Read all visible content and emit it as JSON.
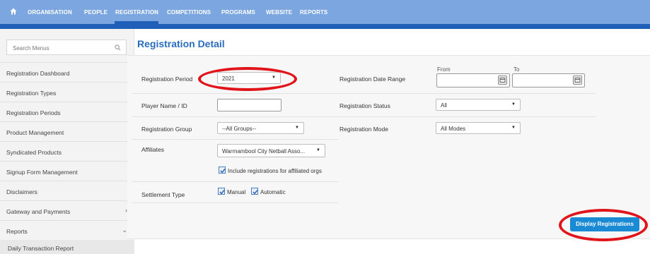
{
  "topnav": {
    "items": [
      "ORGANISATION",
      "PEOPLE",
      "REGISTRATION",
      "COMPETITIONS",
      "PROGRAMS",
      "WEBSITE",
      "REPORTS"
    ]
  },
  "sidebar": {
    "search_placeholder": "Search Menus",
    "items": [
      {
        "label": "Registration Dashboard"
      },
      {
        "label": "Registration Types"
      },
      {
        "label": "Registration Periods"
      },
      {
        "label": "Product Management"
      },
      {
        "label": "Syndicated Products"
      },
      {
        "label": "Signup Form Management"
      },
      {
        "label": "Disclaimers"
      },
      {
        "label": "Gateway and Payments",
        "chevron": "›"
      },
      {
        "label": "Reports",
        "chevron": "⌄"
      }
    ],
    "subitems": [
      {
        "label": "Daily Transaction Report"
      }
    ]
  },
  "main": {
    "title": "Registration Detail",
    "form": {
      "registration_period": {
        "label": "Registration Period",
        "value": "2021"
      },
      "player_name": {
        "label": "Player Name / ID",
        "value": ""
      },
      "registration_group": {
        "label": "Registration Group",
        "value": "--All Groups--"
      },
      "affiliates": {
        "label": "Affiliates",
        "value": "Warrnambool City Netball Asso...",
        "include_affiliated": {
          "label": "Include registrations for affiliated orgs",
          "checked": true
        }
      },
      "settlement_type": {
        "label": "Settlement Type",
        "manual": {
          "label": "Manual",
          "checked": true
        },
        "automatic": {
          "label": "Automatic",
          "checked": true
        }
      },
      "registration_date_range": {
        "label": "Registration Date Range",
        "from_label": "From",
        "to_label": "To",
        "from_value": "",
        "to_value": ""
      },
      "registration_status": {
        "label": "Registration Status",
        "value": "All"
      },
      "registration_mode": {
        "label": "Registration Mode",
        "value": "All Modes"
      }
    },
    "display_button": "Display Registrations"
  },
  "annotations": {
    "highlight_color": "#e0141a"
  }
}
